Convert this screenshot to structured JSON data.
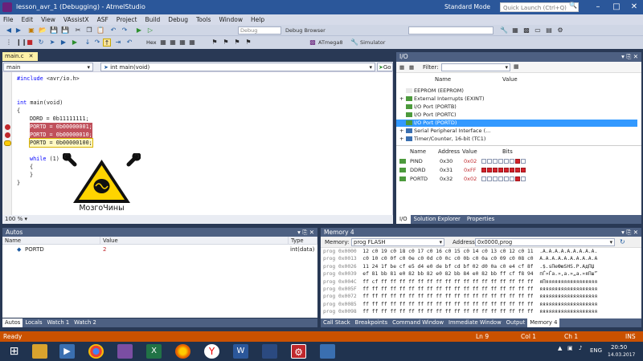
{
  "window": {
    "title": "lesson_avr_1 (Debugging) - AtmelStudio",
    "mode": "Standard Mode",
    "quick_launch": "Quick Launch (Ctrl+Q)"
  },
  "menu": [
    "File",
    "Edit",
    "View",
    "VAssistX",
    "ASF",
    "Project",
    "Build",
    "Debug",
    "Tools",
    "Window",
    "Help"
  ],
  "toolbar": {
    "config": "Debug",
    "browser": "Debug Browser",
    "hex": "Hex",
    "device": "ATmega8",
    "tool": "Simulator"
  },
  "editor": {
    "tab": "main.c",
    "nav_left": "main",
    "nav_right": "int main(void)",
    "go": "Go",
    "zoom": "100 %",
    "lines": [
      {
        "text": "#include <avr/io.h>",
        "indent": 0
      },
      {
        "text": "",
        "indent": 0
      },
      {
        "text": "",
        "indent": 0
      },
      {
        "text": "int main(void)",
        "indent": 0
      },
      {
        "text": "{",
        "indent": 0
      },
      {
        "text": "DDRD = 0b11111111;",
        "indent": 2
      },
      {
        "text": "PORTD = 0b00000001;",
        "indent": 2
      },
      {
        "text": "PORTD = 0b00000010;",
        "indent": 2
      },
      {
        "text": "PORTD = 0b00000100;",
        "indent": 2
      },
      {
        "text": "",
        "indent": 0
      },
      {
        "text": "while (1)",
        "indent": 2
      },
      {
        "text": "{",
        "indent": 2
      },
      {
        "text": "}",
        "indent": 2
      },
      {
        "text": "}",
        "indent": 0
      }
    ]
  },
  "logo": {
    "text": "МозгоЧины"
  },
  "io": {
    "title": "I/O",
    "filter_label": "Filter:",
    "col_name": "Name",
    "col_value": "Value",
    "tree": [
      {
        "label": "EEPROM (EEPROM)",
        "expand": ""
      },
      {
        "label": "External Interrupts (EXINT)",
        "expand": "+"
      },
      {
        "label": "I/O Port (PORTB)",
        "expand": ""
      },
      {
        "label": "I/O Port (PORTC)",
        "expand": ""
      },
      {
        "label": "I/O Port (PORTD)",
        "expand": "",
        "selected": true
      },
      {
        "label": "Serial Peripheral Interface (...",
        "expand": "+"
      },
      {
        "label": "Timer/Counter, 16-bit (TC1)",
        "expand": "+"
      }
    ],
    "reg_headers": {
      "name": "Name",
      "address": "Address",
      "value": "Value",
      "bits": "Bits"
    },
    "registers": [
      {
        "name": "PIND",
        "address": "0x30",
        "value": "0x02",
        "bits": [
          0,
          0,
          0,
          0,
          0,
          0,
          1,
          0
        ]
      },
      {
        "name": "DDRD",
        "address": "0x31",
        "value": "0xFF",
        "bits": [
          1,
          1,
          1,
          1,
          1,
          1,
          1,
          1
        ]
      },
      {
        "name": "PORTD",
        "address": "0x32",
        "value": "0x02",
        "bits": [
          0,
          0,
          0,
          0,
          0,
          0,
          1,
          0
        ]
      }
    ],
    "tabs": [
      "I/O",
      "Solution Explorer",
      "Properties"
    ]
  },
  "autos": {
    "title": "Autos",
    "headers": {
      "name": "Name",
      "value": "Value",
      "type": "Type"
    },
    "rows": [
      {
        "name": "PORTD",
        "value": "2",
        "type": "int(data)"
      }
    ],
    "tabs": [
      "Autos",
      "Locals",
      "Watch 1",
      "Watch 2"
    ]
  },
  "memory": {
    "title": "Memory 4",
    "mem_label": "Memory:",
    "mem_value": "prog FLASH",
    "addr_label": "Address:",
    "addr_value": "0x0000,prog",
    "rows": [
      {
        "addr": "prog 0x0000",
        "hex": "12 c0 19 c0 18 c0 17 c0 16 c0 15 c0 14 c0 13 c0 12 c0 11",
        "ascii": ".A.A.A.A.A.A.A.A.A."
      },
      {
        "addr": "prog 0x0013",
        "hex": "c0 10 c0 0f c0 0e c0 0d c0 0c c0 0b c0 0a c0 09 c0 08 c0",
        "ascii": "A.A.A.A.A.A.A.A.A.A"
      },
      {
        "addr": "prog 0x0026",
        "hex": "11 24 1f be cf e5 d4 e0 de bf cd bf 02 d0 0a c0 e4 cf 8f",
        "ascii": ".$.ѕПеФюЅНЅ.Р.АдПЏ"
      },
      {
        "addr": "prog 0x0039",
        "hex": "ef 81 bb 81 e0 82 bb 82 e0 82 bb 84 e0 82 bb ff cf f8 94",
        "ascii": "пЃ»Ѓа.»‚а.»„а.»яПш”"
      },
      {
        "addr": "prog 0x004C",
        "hex": "ff cf ff ff ff ff ff ff ff ff ff ff ff ff ff ff ff ff ff",
        "ascii": "яПяяяяяяяяяяяяяяяяя"
      },
      {
        "addr": "prog 0x005F",
        "hex": "ff ff ff ff ff ff ff ff ff ff ff ff ff ff ff ff ff ff ff",
        "ascii": "яяяяяяяяяяяяяяяяяяя"
      },
      {
        "addr": "prog 0x0072",
        "hex": "ff ff ff ff ff ff ff ff ff ff ff ff ff ff ff ff ff ff ff",
        "ascii": "яяяяяяяяяяяяяяяяяяя"
      },
      {
        "addr": "prog 0x0085",
        "hex": "ff ff ff ff ff ff ff ff ff ff ff ff ff ff ff ff ff ff ff",
        "ascii": "яяяяяяяяяяяяяяяяяяя"
      },
      {
        "addr": "prog 0x0098",
        "hex": "ff ff ff ff ff ff ff ff ff ff ff ff ff ff ff ff ff ff ff",
        "ascii": "яяяяяяяяяяяяяяяяяяя"
      }
    ],
    "tabs": [
      "Call Stack",
      "Breakpoints",
      "Command Window",
      "Immediate Window",
      "Output",
      "Memory 4"
    ]
  },
  "status": {
    "ready": "Ready",
    "ln": "Ln 9",
    "col": "Col 1",
    "ch": "Ch 1",
    "ins": "INS"
  },
  "taskbar": {
    "lang": "ENG",
    "time": "20:50",
    "date": "14.03.2017"
  },
  "colors": {
    "accent": "#2b579a",
    "status": "#ca5100",
    "panel_header": "#4d6082",
    "breakpoint": "#c0282c"
  }
}
